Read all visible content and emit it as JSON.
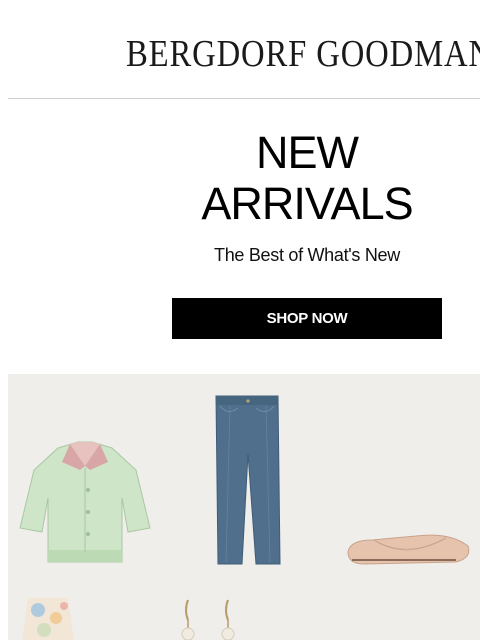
{
  "header": {
    "logo_text": "BERGDORF GOODMAN"
  },
  "hero": {
    "headline_line1": "NEW",
    "headline_line2": "ARRIVALS",
    "subheadline": "The Best of What's New",
    "cta_label": "SHOP NOW"
  },
  "products": [
    {
      "name": "green-knit-blouse-image"
    },
    {
      "name": "blue-corduroy-jeans-image"
    },
    {
      "name": "blush-mesh-ballet-flat-image"
    },
    {
      "name": "floral-print-garment-image"
    },
    {
      "name": "pearl-drop-earrings-image"
    }
  ],
  "colors": {
    "brand": "#1a1a1a",
    "cta_background": "#000000",
    "panel_background": "#efeeea"
  }
}
